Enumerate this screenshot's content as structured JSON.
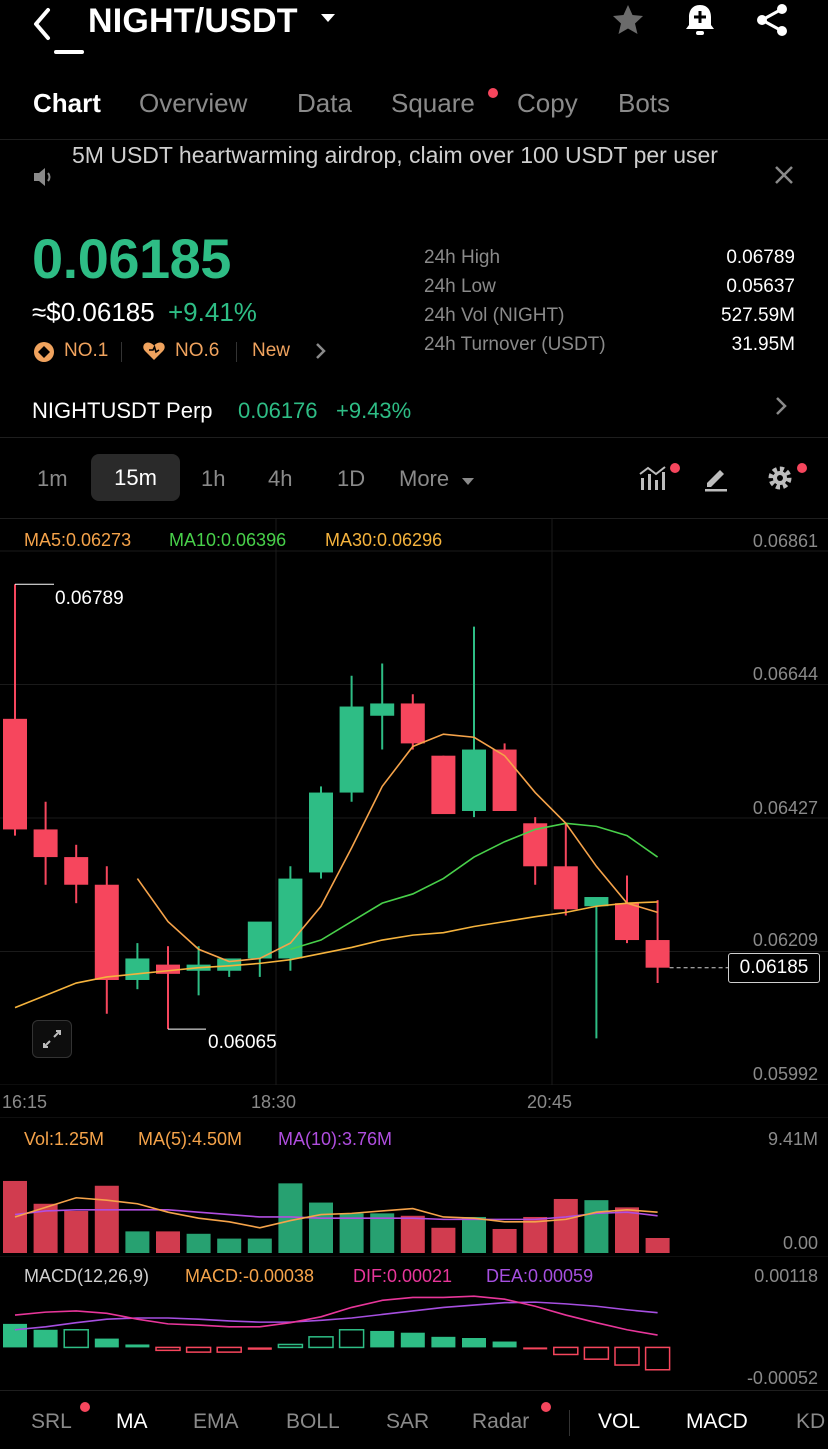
{
  "header": {
    "pair": "NIGHT/USDT",
    "icons": [
      "back-icon",
      "chevron-down-icon",
      "star-icon",
      "bell-plus-icon",
      "share-icon"
    ]
  },
  "tabs": [
    {
      "label": "Chart",
      "active": true
    },
    {
      "label": "Overview"
    },
    {
      "label": "Data"
    },
    {
      "label": "Square",
      "dot": true
    },
    {
      "label": "Copy"
    },
    {
      "label": "Bots"
    }
  ],
  "announcement": {
    "text": "5M USDT heartwarming airdrop, claim over 100 USDT per user"
  },
  "price": {
    "last": "0.06185",
    "usd": "≈$0.06185",
    "change": "+9.41%",
    "badges": [
      "NO.1",
      "NO.6",
      "New"
    ]
  },
  "stats": [
    {
      "label": "24h High",
      "value": "0.06789"
    },
    {
      "label": "24h Low",
      "value": "0.05637"
    },
    {
      "label": "24h Vol (NIGHT)",
      "value": "527.59M"
    },
    {
      "label": "24h Turnover (USDT)",
      "value": "31.95M"
    }
  ],
  "perp": {
    "name": "NIGHTUSDT Perp",
    "price": "0.06176",
    "change": "+9.43%"
  },
  "intervals": [
    "1m",
    "15m",
    "1h",
    "4h",
    "1D",
    "More"
  ],
  "active_interval": "15m",
  "ma_labels": {
    "ma5": "MA5:0.06273",
    "ma10": "MA10:0.06396",
    "ma30": "MA30:0.06296"
  },
  "price_axis": [
    "0.06861",
    "0.06644",
    "0.06427",
    "0.06209",
    "0.05992"
  ],
  "current_price_tag": "0.06185",
  "high_marker": "0.06789",
  "low_marker": "0.06065",
  "time_axis": [
    "16:15",
    "18:30",
    "20:45"
  ],
  "volume": {
    "vol": "Vol:1.25M",
    "ma5": "MA(5):4.50M",
    "ma10": "MA(10):3.76M",
    "axis_top": "9.41M",
    "axis_bottom": "0.00"
  },
  "macd": {
    "title": "MACD(12,26,9)",
    "macd": "MACD:-0.00038",
    "dif": "DIF:0.00021",
    "dea": "DEA:0.00059",
    "axis_top": "0.00118",
    "axis_bottom": "-0.00052"
  },
  "bottom_indicators": [
    {
      "label": "SRL",
      "dot": true
    },
    {
      "label": "MA",
      "on": true
    },
    {
      "label": "EMA"
    },
    {
      "label": "BOLL"
    },
    {
      "label": "SAR"
    },
    {
      "label": "Radar",
      "dot": true
    },
    {
      "label": "VOL",
      "on": true
    },
    {
      "label": "MACD",
      "on": true
    },
    {
      "label": "KD"
    }
  ],
  "colors": {
    "up": "#2ebd85",
    "down": "#f6465d",
    "ma5": "#f5a34a",
    "ma10": "#48d04a",
    "ma30": "#f5b33d",
    "vol_ma10": "#b04ee0",
    "dif": "#e8369a",
    "dea": "#a64fe0"
  },
  "chart_data": {
    "type": "candlestick",
    "interval": "15m",
    "ylim": [
      0.05992,
      0.06861
    ],
    "candles": [
      {
        "o": 0.0657,
        "h": 0.06789,
        "l": 0.0638,
        "c": 0.0639
      },
      {
        "o": 0.0639,
        "h": 0.06435,
        "l": 0.063,
        "c": 0.06345
      },
      {
        "o": 0.06345,
        "h": 0.06365,
        "l": 0.0627,
        "c": 0.063
      },
      {
        "o": 0.063,
        "h": 0.0633,
        "l": 0.0609,
        "c": 0.06145
      },
      {
        "o": 0.06145,
        "h": 0.06205,
        "l": 0.0613,
        "c": 0.0618
      },
      {
        "o": 0.0617,
        "h": 0.062,
        "l": 0.06065,
        "c": 0.06155
      },
      {
        "o": 0.0616,
        "h": 0.062,
        "l": 0.0612,
        "c": 0.0617
      },
      {
        "o": 0.0616,
        "h": 0.0618,
        "l": 0.0615,
        "c": 0.0618
      },
      {
        "o": 0.0618,
        "h": 0.062,
        "l": 0.0615,
        "c": 0.0624
      },
      {
        "o": 0.0618,
        "h": 0.0633,
        "l": 0.0616,
        "c": 0.0631
      },
      {
        "o": 0.0632,
        "h": 0.0646,
        "l": 0.0631,
        "c": 0.0645
      },
      {
        "o": 0.0645,
        "h": 0.0664,
        "l": 0.06435,
        "c": 0.0659
      },
      {
        "o": 0.06575,
        "h": 0.0666,
        "l": 0.0652,
        "c": 0.06595
      },
      {
        "o": 0.06595,
        "h": 0.0661,
        "l": 0.0652,
        "c": 0.0653
      },
      {
        "o": 0.0651,
        "h": 0.0651,
        "l": 0.0643,
        "c": 0.06415
      },
      {
        "o": 0.0642,
        "h": 0.0672,
        "l": 0.0641,
        "c": 0.0652
      },
      {
        "o": 0.0652,
        "h": 0.0653,
        "l": 0.0643,
        "c": 0.0642
      },
      {
        "o": 0.064,
        "h": 0.0641,
        "l": 0.063,
        "c": 0.0633
      },
      {
        "o": 0.0633,
        "h": 0.064,
        "l": 0.0625,
        "c": 0.0626
      },
      {
        "o": 0.06265,
        "h": 0.0627,
        "l": 0.0605,
        "c": 0.0628
      },
      {
        "o": 0.0627,
        "h": 0.06315,
        "l": 0.06205,
        "c": 0.0621
      },
      {
        "o": 0.0621,
        "h": 0.06275,
        "l": 0.0614,
        "c": 0.06165
      }
    ],
    "ma5": [
      null,
      null,
      null,
      null,
      0.0631,
      0.0624,
      0.06195,
      0.06175,
      0.0618,
      0.06205,
      0.06265,
      0.0636,
      0.0646,
      0.06525,
      0.06545,
      0.0654,
      0.0651,
      0.0645,
      0.064,
      0.0633,
      0.0627,
      0.06255
    ],
    "ma10": [
      null,
      null,
      null,
      null,
      null,
      null,
      null,
      null,
      null,
      0.06195,
      0.0621,
      0.0624,
      0.0627,
      0.06285,
      0.0631,
      0.06345,
      0.0637,
      0.0639,
      0.064,
      0.06395,
      0.0638,
      0.06345
    ],
    "ma30": [
      0.061,
      0.0612,
      0.0614,
      0.0615,
      0.06155,
      0.0616,
      0.06165,
      0.06168,
      0.06172,
      0.06178,
      0.06188,
      0.06198,
      0.0621,
      0.06218,
      0.06222,
      0.06232,
      0.0624,
      0.06248,
      0.06255,
      0.06265,
      0.0627,
      0.06272
    ],
    "volume": [
      6.0,
      4.1,
      3.5,
      5.6,
      1.8,
      1.8,
      1.6,
      1.2,
      1.2,
      5.8,
      4.2,
      3.3,
      3.3,
      3.1,
      2.1,
      3.0,
      2.0,
      3.0,
      4.5,
      4.4,
      3.8,
      1.25
    ],
    "vol_ma5": [
      3.0,
      3.8,
      4.6,
      4.4,
      4.1,
      3.4,
      2.9,
      2.6,
      2.1,
      2.7,
      3.2,
      3.3,
      3.5,
      3.7,
      3.0,
      2.9,
      2.6,
      2.6,
      2.8,
      3.4,
      3.6,
      3.4
    ],
    "vol_ma10": [
      3.2,
      3.5,
      3.6,
      3.6,
      3.6,
      3.6,
      3.4,
      3.2,
      3.0,
      3.0,
      2.9,
      2.9,
      2.9,
      2.9,
      2.8,
      2.8,
      2.8,
      2.8,
      3.0,
      3.3,
      3.4,
      3.1
    ],
    "vol_ylim": [
      0,
      9.41
    ],
    "macd_hist": [
      0.0004,
      0.0003,
      0.0003,
      0.00015,
      5e-05,
      -5e-05,
      -8e-05,
      -8e-05,
      -4e-05,
      5e-05,
      0.00018,
      0.0003,
      0.00028,
      0.00025,
      0.00018,
      0.00016,
      0.0001,
      -3e-05,
      -0.00012,
      -0.0002,
      -0.0003,
      -0.00038
    ],
    "dif": [
      0.00055,
      0.0006,
      0.00062,
      0.00058,
      0.00048,
      0.0004,
      0.00038,
      0.00035,
      0.00035,
      0.00042,
      0.00052,
      0.00068,
      0.0008,
      0.00085,
      0.00085,
      0.00087,
      0.00082,
      0.0007,
      0.00055,
      0.00042,
      0.0003,
      0.00021
    ],
    "dea": [
      0.0003,
      0.00035,
      0.00042,
      0.00048,
      0.0005,
      0.0005,
      0.00048,
      0.00045,
      0.00043,
      0.00043,
      0.00046,
      0.0005,
      0.00056,
      0.00062,
      0.00068,
      0.00072,
      0.00076,
      0.00077,
      0.00074,
      0.0007,
      0.00064,
      0.00059
    ],
    "macd_ylim": [
      -0.00052,
      0.00118
    ]
  }
}
